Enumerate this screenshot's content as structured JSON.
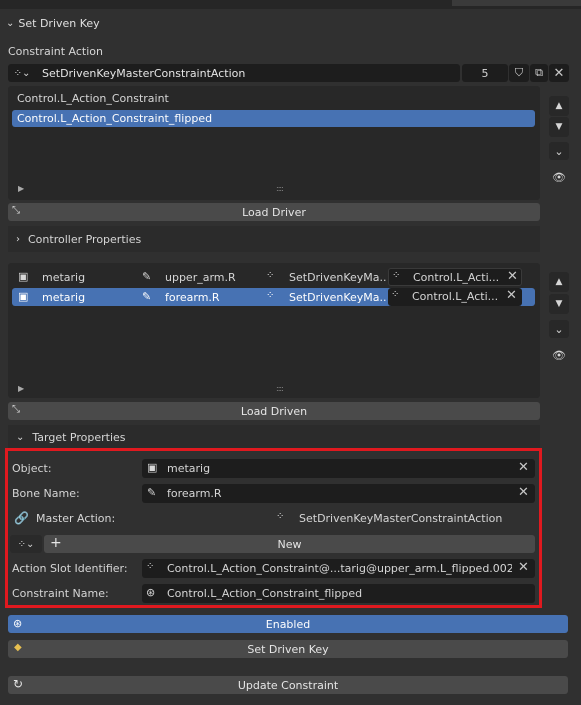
{
  "header": {
    "title": "Set Driven Key"
  },
  "constraint_action": {
    "label": "Constraint Action",
    "action_name": "SetDrivenKeyMasterConstraintAction",
    "users": "5",
    "driver_list": [
      "Control.L_Action_Constraint",
      "Control.L_Action_Constraint_flipped"
    ],
    "load_driver": "Load Driver"
  },
  "controller_properties": {
    "label": "Controller Properties"
  },
  "driven_list": {
    "rows": [
      {
        "object": "metarig",
        "bone": "upper_arm.R",
        "action": "SetDrivenKeyMa...",
        "constraint": "Control.L_Acti..."
      },
      {
        "object": "metarig",
        "bone": "forearm.R",
        "action": "SetDrivenKeyMa...",
        "constraint": "Control.L_Acti..."
      }
    ],
    "load_driven": "Load Driven"
  },
  "target_properties": {
    "label": "Target Properties",
    "object_label": "Object:",
    "object_value": "metarig",
    "bone_label": "Bone Name:",
    "bone_value": "forearm.R",
    "master_label": "Master Action:",
    "master_value": "SetDrivenKeyMasterConstraintAction",
    "new_label": "New",
    "slot_label": "Action Slot Identifier:",
    "slot_value": "Control.L_Action_Constraint@...tarig@upper_arm.L_flipped.002",
    "cname_label": "Constraint Name:",
    "cname_value": "Control.L_Action_Constraint_flipped"
  },
  "buttons": {
    "enabled": "Enabled",
    "set_driven_key": "Set Driven Key",
    "update_constraint": "Update Constraint"
  },
  "colors": {
    "selection": "#4772b3",
    "highlight_box": "#e0191f"
  }
}
